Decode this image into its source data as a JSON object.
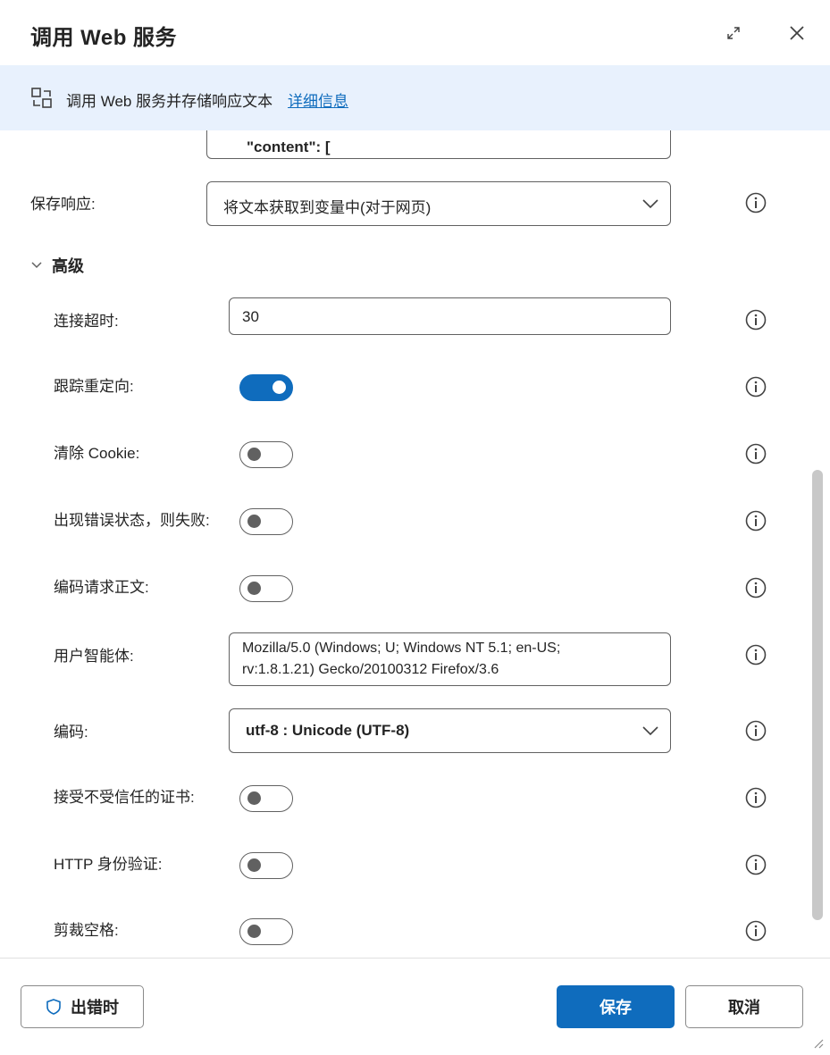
{
  "header": {
    "title": "调用 Web 服务"
  },
  "banner": {
    "text": "调用 Web 服务并存储响应文本",
    "link": "详细信息"
  },
  "body_snippet": "\"content\": [",
  "save_response": {
    "label": "保存响应:",
    "value": "将文本获取到变量中(对于网页)"
  },
  "advanced": {
    "title": "高级",
    "connection_timeout": {
      "label": "连接超时:",
      "value": "30"
    },
    "follow_redirects": {
      "label": "跟踪重定向:",
      "on": true
    },
    "clear_cookie": {
      "label": "清除 Cookie:",
      "on": false
    },
    "fail_on_error": {
      "label": "出现错误状态，则失败:",
      "on": false
    },
    "encode_body": {
      "label": "编码请求正文:",
      "on": false
    },
    "user_agent": {
      "label": "用户智能体:",
      "line1": "Mozilla/5.0 (Windows; U; Windows NT 5.1; en-US;",
      "line2": "rv:1.8.1.21) Gecko/20100312 Firefox/3.6"
    },
    "encoding": {
      "label": "编码:",
      "value": "utf-8 : Unicode (UTF-8)"
    },
    "accept_untrusted": {
      "label": "接受不受信任的证书:",
      "on": false
    },
    "http_auth": {
      "label": "HTTP 身份验证:",
      "on": false
    },
    "trim_whitespace": {
      "label": "剪裁空格:",
      "on": false
    }
  },
  "footer": {
    "on_error": "出错时",
    "save": "保存",
    "cancel": "取消"
  },
  "colors": {
    "accent": "#0f6cbd",
    "banner_bg": "#e8f1fd"
  }
}
